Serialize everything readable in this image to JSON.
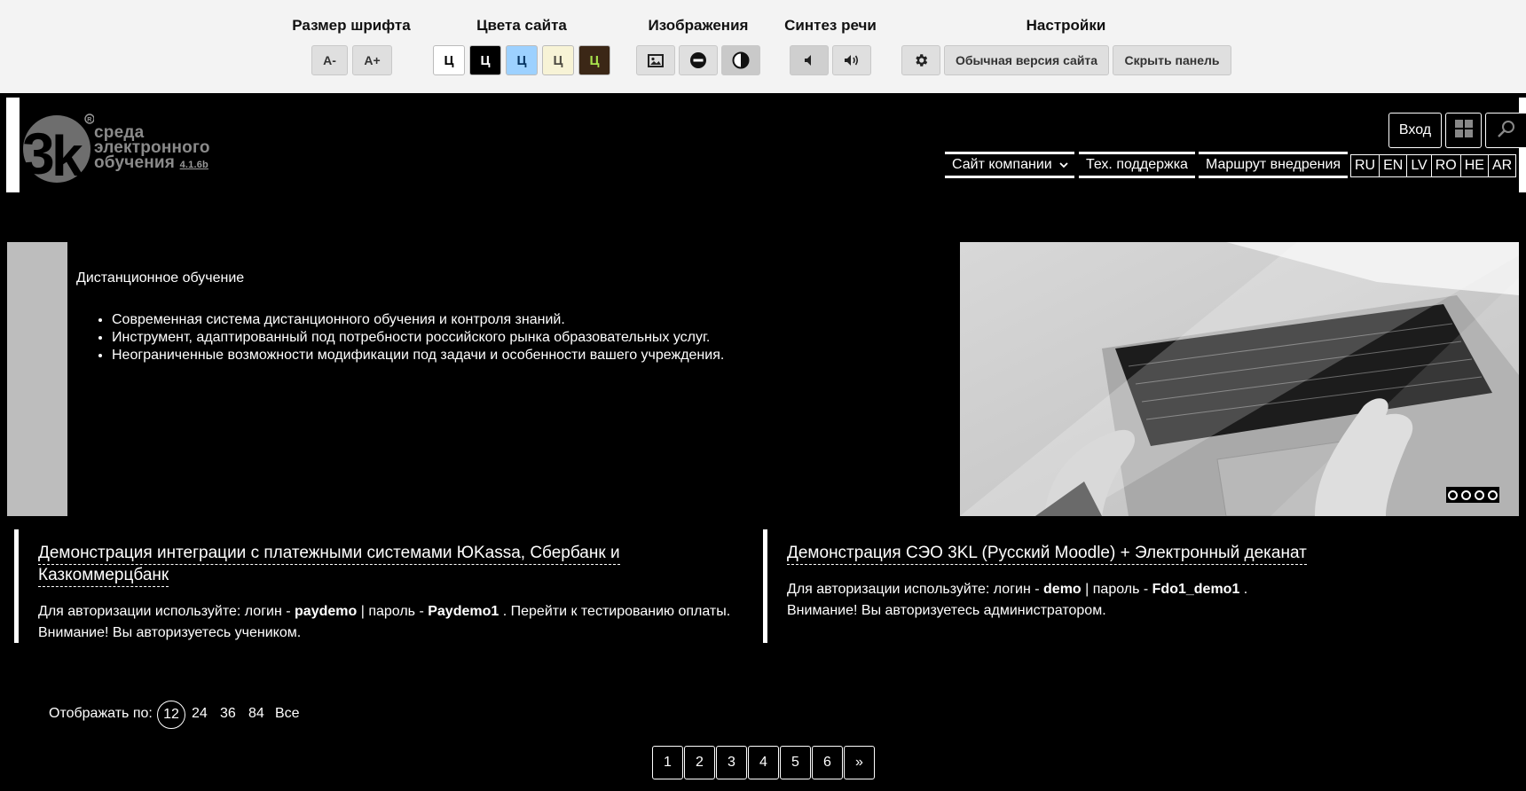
{
  "panel": {
    "font_size": {
      "title": "Размер шрифта",
      "decrease": "А-",
      "increase": "А+"
    },
    "colors": {
      "title": "Цвета сайта",
      "schemes": [
        {
          "label": "Ц",
          "bg": "#ffffff",
          "fg": "#000000"
        },
        {
          "label": "Ц",
          "bg": "#000000",
          "fg": "#ffffff"
        },
        {
          "label": "Ц",
          "bg": "#9dd1ff",
          "fg": "#063462"
        },
        {
          "label": "Ц",
          "bg": "#f7f3d6",
          "fg": "#4d4b43"
        },
        {
          "label": "Ц",
          "bg": "#3b2716",
          "fg": "#a9e44d"
        }
      ]
    },
    "images": {
      "title": "Изображения",
      "buttons": [
        "image-icon",
        "images-off-icon",
        "grayscale-icon"
      ]
    },
    "speech": {
      "title": "Синтез речи",
      "buttons": [
        "speaker-off-icon",
        "speaker-on-icon"
      ]
    },
    "settings": {
      "title": "Настройки",
      "normal_version": "Обычная версия сайта",
      "hide_panel": "Скрыть панель"
    }
  },
  "header": {
    "logo_lines": [
      "среда",
      "электронного",
      "обучения"
    ],
    "logo_version": "4.1.6b",
    "login": "Вход",
    "nav": [
      "Сайт компании",
      "Тех. поддержка",
      "Маршрут внедрения"
    ],
    "languages": [
      "RU",
      "EN",
      "LV",
      "RO",
      "HE",
      "AR"
    ]
  },
  "slider": {
    "title": "Дистанционное обучение",
    "items": [
      "Современная система дистанционного обучения и контроля знаний.",
      "Инструмент, адаптированный под потребности российского рынка образовательных услуг.",
      "Неограниченные возможности модификации под задачи и особенности вашего учреждения."
    ],
    "dots": 4
  },
  "cards": [
    {
      "title_line1": "Демонстрация интеграции с платежными системами ЮKassa, Сбербанк и",
      "title_line2": "Казкоммерцбанк",
      "text_prefix": "Для авторизации используйте: логин - ",
      "login": "paydemo",
      "text_mid": " | пароль - ",
      "password": "Paydemo1",
      "text_suffix": " . Перейти к тестированию оплаты.",
      "note": "Внимание! Вы авторизуетесь учеником."
    },
    {
      "title_line1": "Демонстрация СЭО 3KL (Русский Moodle) + Электронный деканат",
      "text_prefix": "Для авторизации используйте: логин - ",
      "login": "demo",
      "text_mid": " | пароль - ",
      "password": "Fdo1_demo1",
      "text_suffix": " .",
      "note": "Внимание! Вы авторизуетесь администратором."
    }
  ],
  "per_page": {
    "label": "Отображать по:",
    "options": [
      "12",
      "24",
      "36",
      "84",
      "Все"
    ],
    "active": "12"
  },
  "pagination": [
    "1",
    "2",
    "3",
    "4",
    "5",
    "6",
    "»"
  ]
}
